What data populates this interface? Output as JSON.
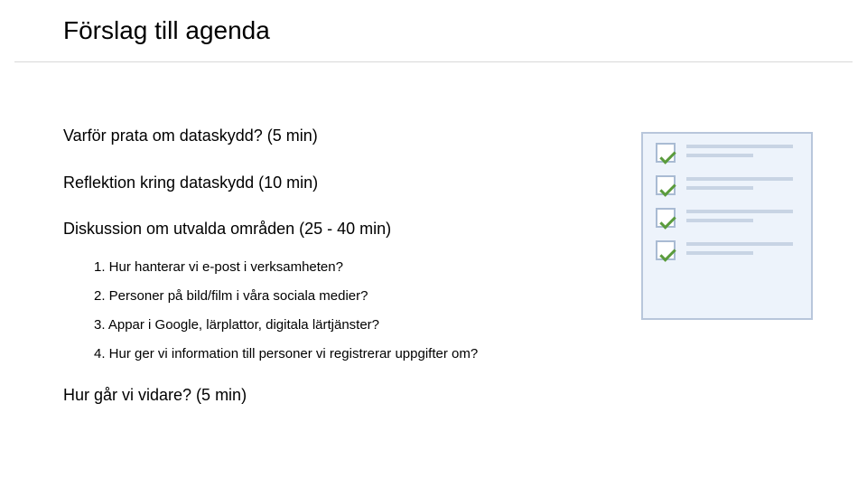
{
  "title": "Förslag till agenda",
  "agenda": {
    "item1": "Varför prata om dataskydd? (5 min)",
    "item2": "Reflektion kring dataskydd (10 min)",
    "item3": "Diskussion om utvalda områden (25 - 40 min)",
    "sub": {
      "s1": "1. Hur hanterar vi e-post i verksamheten?",
      "s2": "2. Personer på bild/film i våra sociala medier?",
      "s3": "3. Appar i Google, lärplattor, digitala lärtjänster?",
      "s4": "4. Hur ger vi information till personer vi registrerar uppgifter om?"
    },
    "item4": "Hur går vi vidare? (5 min)"
  }
}
